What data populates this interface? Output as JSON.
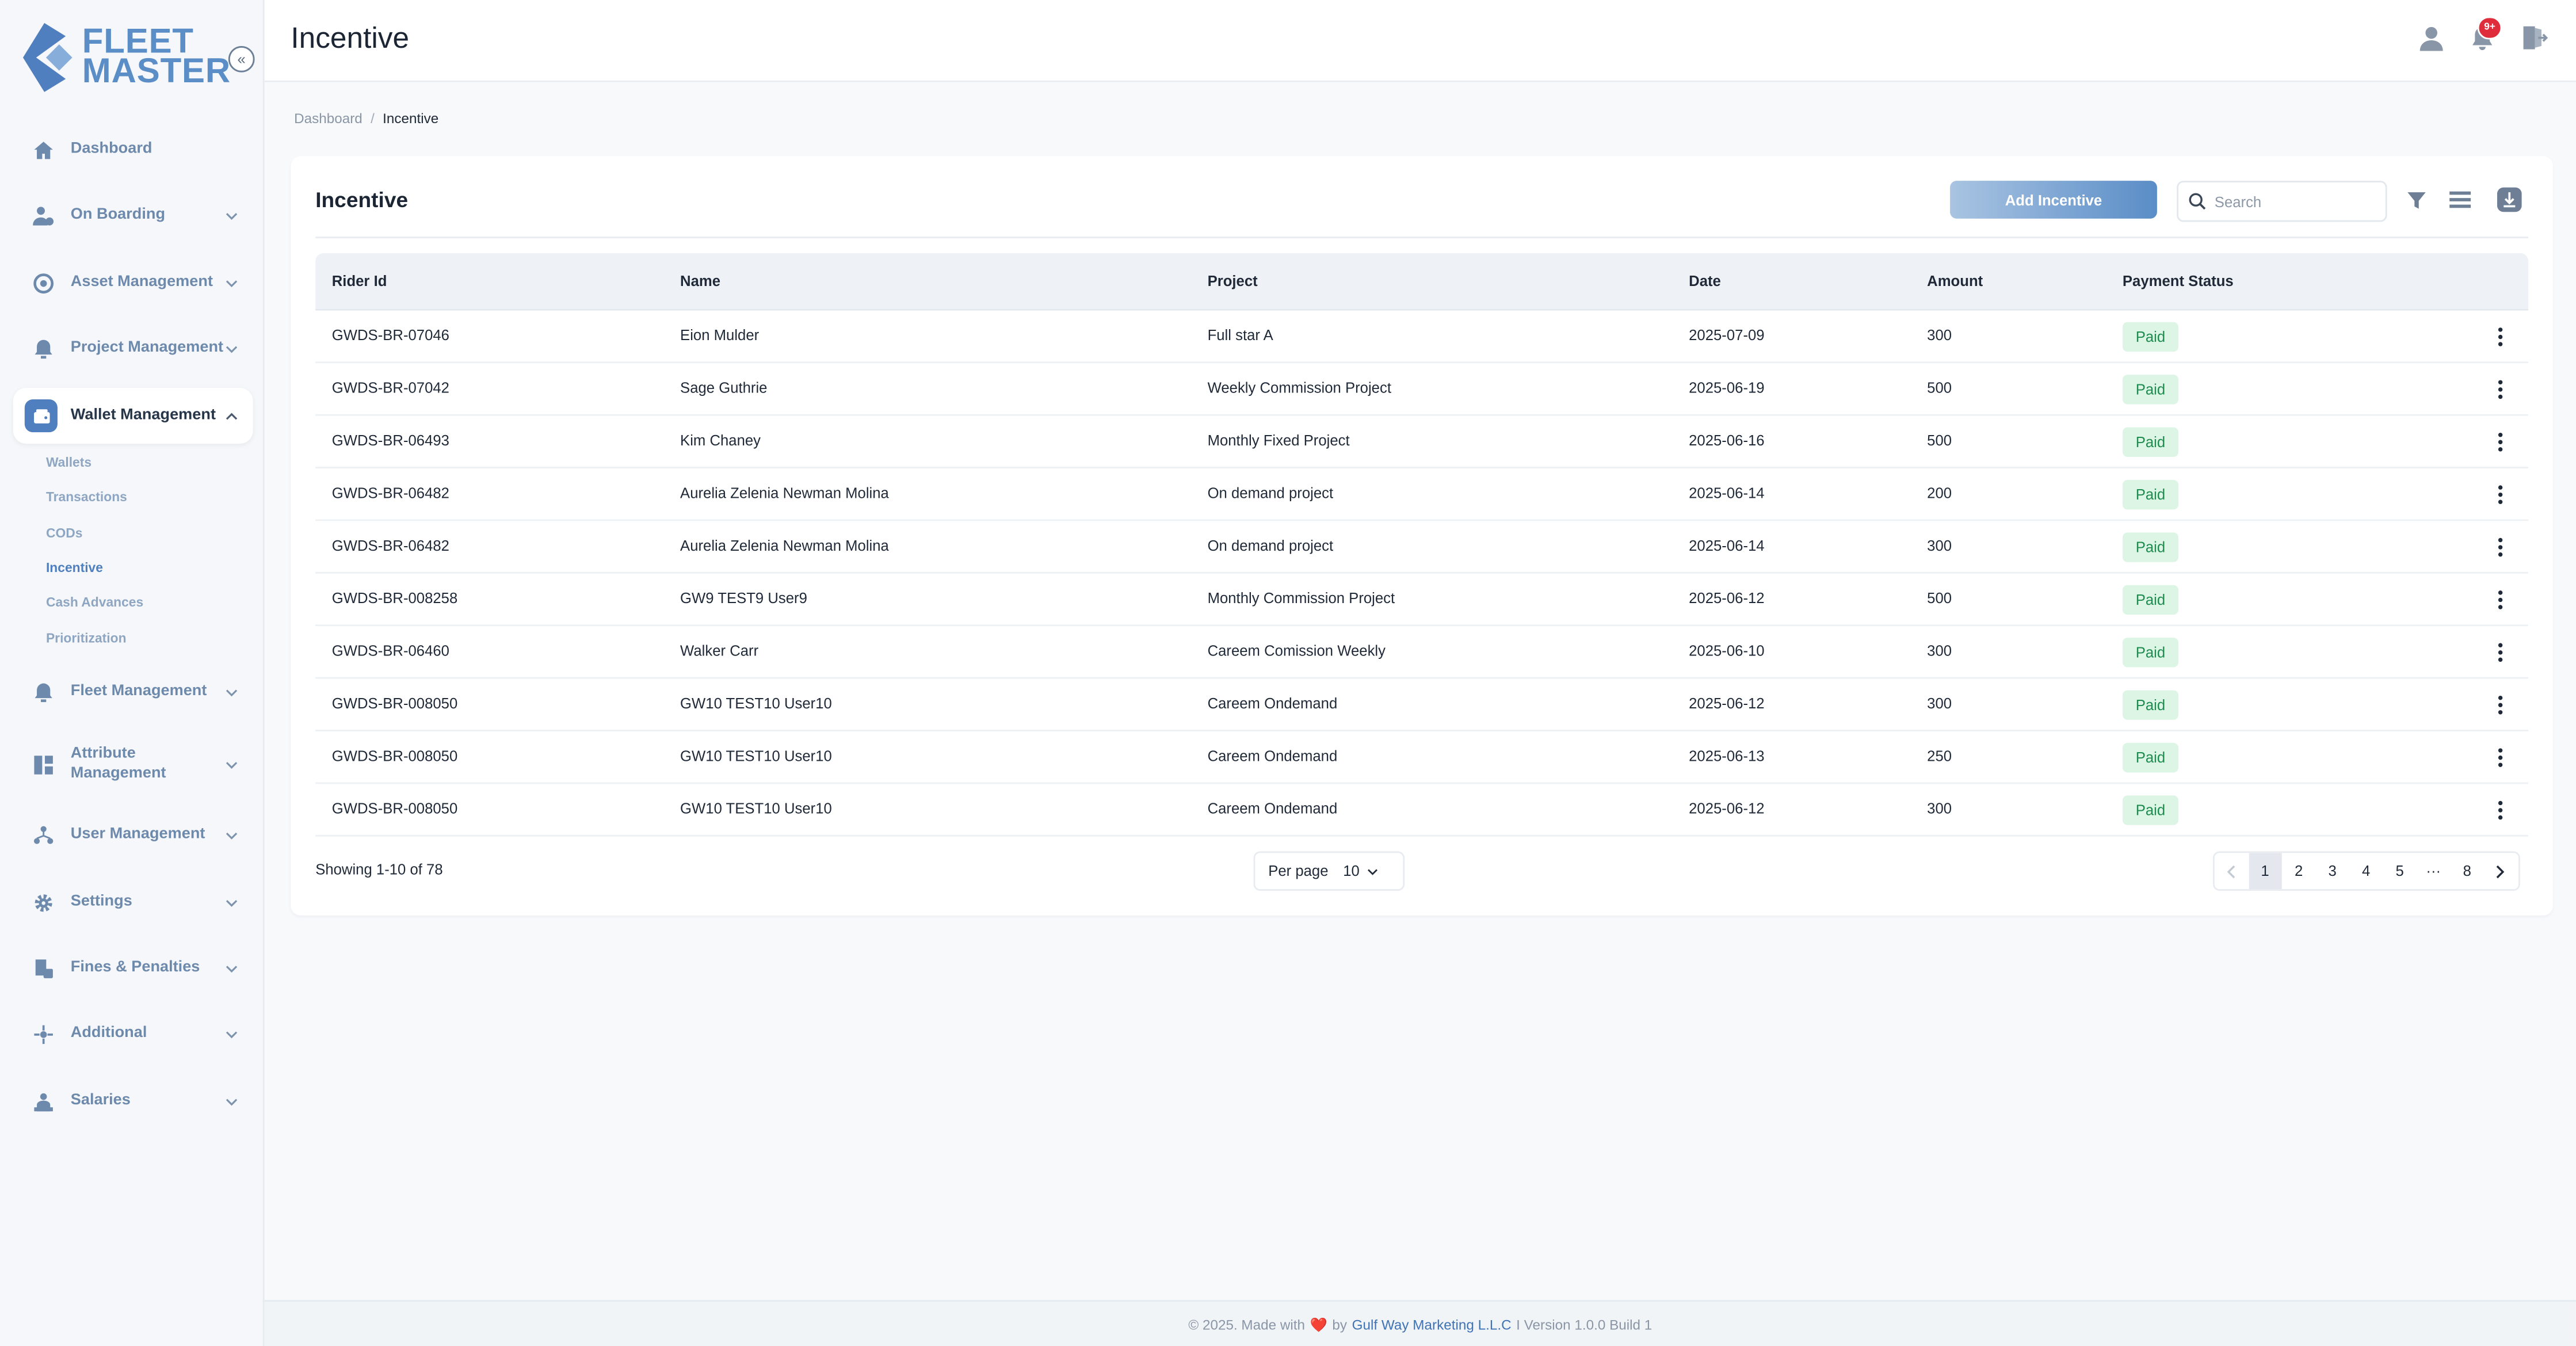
{
  "sidebar": {
    "logo": {
      "line1": "FLEET",
      "line2": "MASTER"
    },
    "items": [
      {
        "label": "Dashboard",
        "icon": "home-icon",
        "top": 0
      },
      {
        "label": "On Boarding",
        "icon": "onboarding-icon"
      },
      {
        "label": "Asset Management",
        "icon": "asset-icon"
      },
      {
        "label": "Project Management",
        "icon": "project-icon"
      },
      {
        "label": "Wallet Management",
        "icon": "wallet-icon"
      },
      {
        "label": "Fleet Management",
        "icon": "fleet-icon"
      },
      {
        "label": "Attribute Management",
        "icon": "attribute-icon"
      },
      {
        "label": "User Management",
        "icon": "users-icon"
      },
      {
        "label": "Settings",
        "icon": "gear-icon"
      },
      {
        "label": "Fines & Penalties",
        "icon": "fines-icon"
      },
      {
        "label": "Additional",
        "icon": "additional-icon"
      },
      {
        "label": "Salaries",
        "icon": "salaries-icon"
      }
    ],
    "wallet_sub": [
      "Wallets",
      "Transactions",
      "CODs",
      "Incentive",
      "Cash Advances",
      "Prioritization"
    ],
    "active_sub": "Incentive"
  },
  "header": {
    "title": "Incentive",
    "notification_count": "9+"
  },
  "breadcrumb": {
    "root": "Dashboard",
    "separator": "/",
    "current": "Incentive"
  },
  "card": {
    "title": "Incentive",
    "add_button": "Add Incentive",
    "search_placeholder": "Search"
  },
  "table": {
    "columns": [
      "Rider Id",
      "Name",
      "Project",
      "Date",
      "Amount",
      "Payment Status"
    ],
    "rows": [
      [
        "GWDS-BR-07046",
        "Eion Mulder",
        "Full star A",
        "2025-07-09",
        "300",
        "Paid"
      ],
      [
        "GWDS-BR-07042",
        "Sage Guthrie",
        "Weekly Commission Project",
        "2025-06-19",
        "500",
        "Paid"
      ],
      [
        "GWDS-BR-06493",
        "Kim Chaney",
        "Monthly Fixed Project",
        "2025-06-16",
        "500",
        "Paid"
      ],
      [
        "GWDS-BR-06482",
        "Aurelia Zelenia Newman Molina",
        "On demand project",
        "2025-06-14",
        "200",
        "Paid"
      ],
      [
        "GWDS-BR-06482",
        "Aurelia Zelenia Newman Molina",
        "On demand project",
        "2025-06-14",
        "300",
        "Paid"
      ],
      [
        "GWDS-BR-008258",
        "GW9 TEST9 User9",
        "Monthly Commission Project",
        "2025-06-12",
        "500",
        "Paid"
      ],
      [
        "GWDS-BR-06460",
        "Walker Carr",
        "Careem Comission Weekly",
        "2025-06-10",
        "300",
        "Paid"
      ],
      [
        "GWDS-BR-008050",
        "GW10 TEST10 User10",
        "Careem Ondemand",
        "2025-06-12",
        "300",
        "Paid"
      ],
      [
        "GWDS-BR-008050",
        "GW10 TEST10 User10",
        "Careem Ondemand",
        "2025-06-13",
        "250",
        "Paid"
      ],
      [
        "GWDS-BR-008050",
        "GW10 TEST10 User10",
        "Careem Ondemand",
        "2025-06-12",
        "300",
        "Paid"
      ]
    ]
  },
  "pagination": {
    "showing": "Showing 1-10 of 78",
    "per_page_label": "Per page",
    "per_page_value": "10",
    "pages": [
      "1",
      "2",
      "3",
      "4",
      "5",
      "···",
      "8"
    ],
    "active_page": "1"
  },
  "footer": {
    "prefix": "© 2025. Made with",
    "heart": "❤️",
    "by": "by",
    "company": "Gulf Way Marketing L.L.C",
    "suffix": "I Version 1.0.0 Build 1"
  },
  "colors": {
    "accent": "#4f7fbf",
    "paid_bg": "#dcf5e5",
    "paid_text": "#1e8c4e",
    "badge": "#e02d3c"
  }
}
